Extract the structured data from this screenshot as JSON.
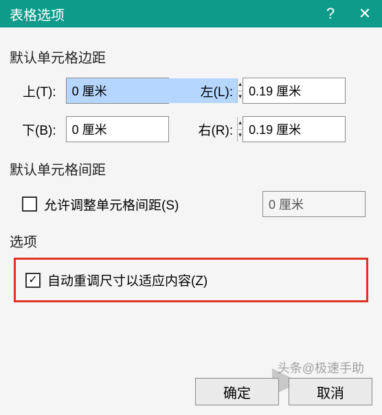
{
  "titlebar": {
    "title": "表格选项",
    "help": "?",
    "close": "✕"
  },
  "section": {
    "margins_label": "默认单元格边距",
    "spacing_label": "默认单元格间距",
    "options_label": "选项"
  },
  "margins": {
    "top_label": "上(T):",
    "top_value": "0 厘米",
    "bottom_label": "下(B):",
    "bottom_value": "0 厘米",
    "left_label": "左(L):",
    "left_value": "0.19 厘米",
    "right_label": "右(R):",
    "right_value": "0.19 厘米"
  },
  "spacing": {
    "checkbox_label": "允许调整单元格间距(S)",
    "value": "0 厘米",
    "checked": false
  },
  "options": {
    "autofit_label": "自动重调尺寸以适应内容(Z)",
    "autofit_checked": true
  },
  "buttons": {
    "ok": "确定",
    "cancel": "取消"
  },
  "watermark": "头条@极速手助"
}
